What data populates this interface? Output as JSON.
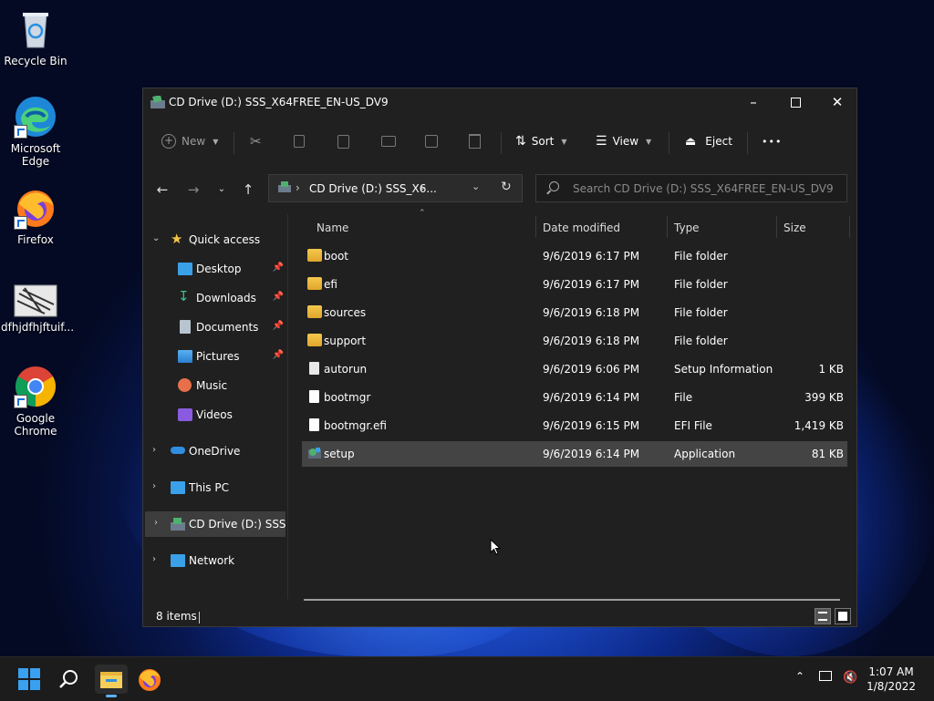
{
  "desktop": {
    "icons": [
      {
        "label": "Recycle Bin",
        "icon": "recycle-bin-icon"
      },
      {
        "label": "Microsoft Edge",
        "icon": "edge-icon"
      },
      {
        "label": "Firefox",
        "icon": "firefox-icon"
      },
      {
        "label": "dfhjdfhjftuif...",
        "icon": "image-file-icon"
      },
      {
        "label": "Google Chrome",
        "icon": "chrome-icon"
      }
    ]
  },
  "window": {
    "title": "CD Drive (D:) SSS_X64FREE_EN-US_DV9",
    "toolbar": {
      "new_label": "New",
      "sort_label": "Sort",
      "view_label": "View",
      "eject_label": "Eject",
      "more_label": "•••"
    },
    "address": {
      "path": "CD Drive (D:) SSS_X6...",
      "search_placeholder": "Search CD Drive (D:) SSS_X64FREE_EN-US_DV9"
    },
    "nav": {
      "quick_access": "Quick access",
      "desktop": "Desktop",
      "downloads": "Downloads",
      "documents": "Documents",
      "pictures": "Pictures",
      "music": "Music",
      "videos": "Videos",
      "onedrive": "OneDrive",
      "this_pc": "This PC",
      "cd_drive": "CD Drive (D:) SSS_X6",
      "network": "Network"
    },
    "columns": {
      "name": "Name",
      "date": "Date modified",
      "type": "Type",
      "size": "Size"
    },
    "files": [
      {
        "name": "boot",
        "date": "9/6/2019 6:17 PM",
        "type": "File folder",
        "size": "",
        "kind": "folder"
      },
      {
        "name": "efi",
        "date": "9/6/2019 6:17 PM",
        "type": "File folder",
        "size": "",
        "kind": "folder"
      },
      {
        "name": "sources",
        "date": "9/6/2019 6:18 PM",
        "type": "File folder",
        "size": "",
        "kind": "folder"
      },
      {
        "name": "support",
        "date": "9/6/2019 6:18 PM",
        "type": "File folder",
        "size": "",
        "kind": "folder"
      },
      {
        "name": "autorun",
        "date": "9/6/2019 6:06 PM",
        "type": "Setup Information",
        "size": "1 KB",
        "kind": "setup-info"
      },
      {
        "name": "bootmgr",
        "date": "9/6/2019 6:14 PM",
        "type": "File",
        "size": "399 KB",
        "kind": "file"
      },
      {
        "name": "bootmgr.efi",
        "date": "9/6/2019 6:15 PM",
        "type": "EFI File",
        "size": "1,419 KB",
        "kind": "file"
      },
      {
        "name": "setup",
        "date": "9/6/2019 6:14 PM",
        "type": "Application",
        "size": "81 KB",
        "kind": "application"
      }
    ],
    "status": "8 items"
  },
  "taskbar": {
    "time": "1:07 AM",
    "date": "1/8/2022"
  },
  "colors": {
    "window_bg": "#202020",
    "selection": "#444444",
    "accent": "#0078d4",
    "folder": "#f0be3f"
  }
}
